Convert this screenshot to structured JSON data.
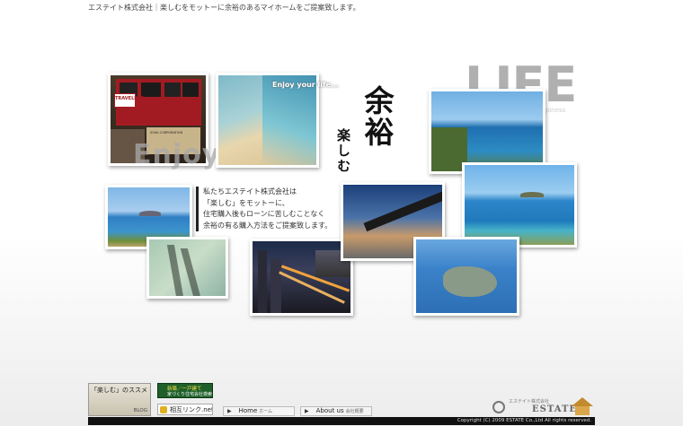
{
  "header": {
    "tagline": "エステイト株式会社｜楽しむをモットーに余裕のあるマイホームをご提案致します。"
  },
  "hero": {
    "enjoy_word": "Enjoy",
    "enjoy_caption": "Enjoy your life...",
    "life_word": "LIFE",
    "life_caption": "~ find happiness",
    "vertical_main": "余裕",
    "vertical_sub": "楽しむ",
    "tram_sign_1": "TRAVELERS",
    "tram_sign_2": "SOXA CORPORATION"
  },
  "intro": {
    "lines": [
      "私たちエステイト株式会社は",
      "「楽しむ」をモットーに、",
      "住宅購入後もローンに苦しむことなく",
      "余裕の有る購入方法をご提案致します。"
    ]
  },
  "banners": {
    "tanoshimu": "「楽しむ」のススメ",
    "blog": "BLOG",
    "shinchiku_1": "新築／一戸建て",
    "shinchiku_2": "家づくり住宅会社検索",
    "sogo_link": "相互リンク.net"
  },
  "nav": {
    "home_label": "Home",
    "home_sub": "ホーム",
    "about_label": "About us",
    "about_sub": "会社概要"
  },
  "footer": {
    "logo_text": "ESTATE",
    "logo_sub": "エステイト株式会社",
    "copyright": "Copyright (C) 2009 ESTATE Co.,Ltd All rights reserved."
  },
  "colors": {
    "ocean": "#2f8fc4",
    "sky": "#5aa9df",
    "sand": "#e8d3a8",
    "tram_red": "#a31b22",
    "accent_dark": "#111111"
  }
}
